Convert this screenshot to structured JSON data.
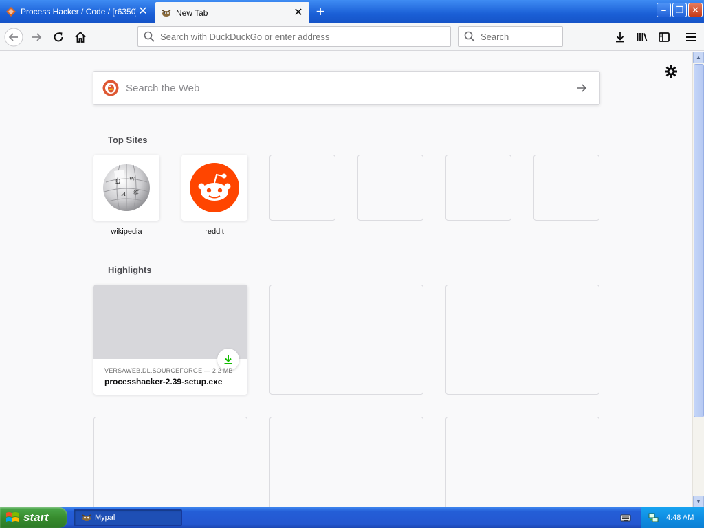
{
  "tabs": [
    {
      "title": "Process Hacker / Code / [r6350]",
      "close": "✕",
      "active": false
    },
    {
      "title": "New Tab",
      "close": "✕",
      "active": true
    }
  ],
  "new_tab_button": "+",
  "window_controls": {
    "minimize": "–",
    "maximize": "❐",
    "close": "✕"
  },
  "navbar": {
    "url_placeholder": "Search with DuckDuckGo or enter address",
    "search_placeholder": "Search"
  },
  "page": {
    "web_search_placeholder": "Search the Web",
    "top_sites_title": "Top Sites",
    "top_sites": [
      {
        "label": "wikipedia",
        "icon": "wikipedia-globe"
      },
      {
        "label": "reddit",
        "icon": "reddit-alien"
      },
      {
        "label": "",
        "icon": ""
      },
      {
        "label": "",
        "icon": ""
      },
      {
        "label": "",
        "icon": ""
      },
      {
        "label": "",
        "icon": ""
      }
    ],
    "highlights_title": "Highlights",
    "highlights": [
      {
        "source": "VERSAWEB.DL.SOURCEFORGE — 2.2 MB",
        "title": "processhacker-2.39-setup.exe",
        "type": "download"
      }
    ]
  },
  "taskbar": {
    "start_label": "start",
    "task_label": "Mypal",
    "clock": "4:48 AM"
  },
  "colors": {
    "titlebar": "#1a5fd6",
    "taskbar": "#245ed7",
    "start": "#378c2e",
    "download_green": "#12bc00",
    "reddit": "#ff4500"
  }
}
